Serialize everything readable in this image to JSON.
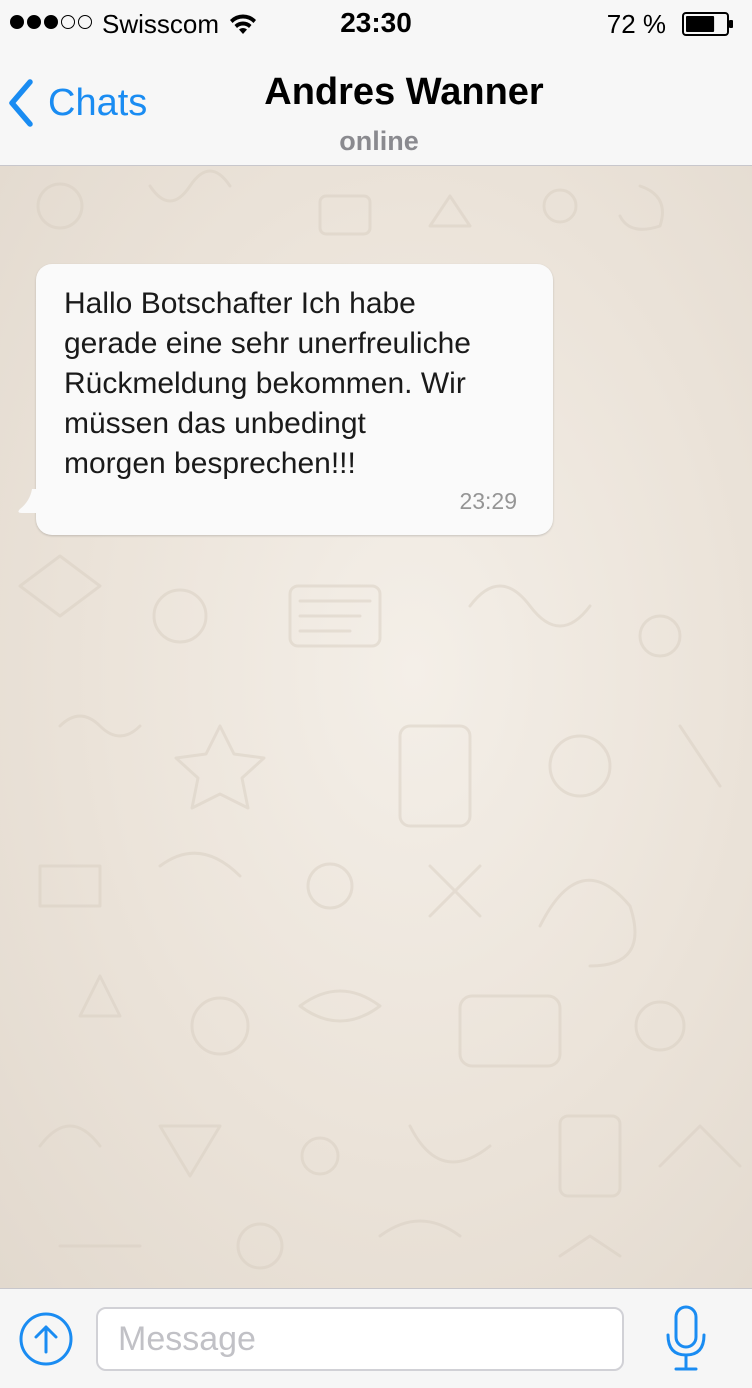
{
  "status_bar": {
    "carrier": "Swisscom",
    "signal_bars_filled": 3,
    "signal_bars_total": 5,
    "time": "23:30",
    "battery_text": "72 %",
    "battery_level": 0.72
  },
  "nav": {
    "back_label": "Chats",
    "contact_name": "Andres Wanner",
    "contact_status": "online"
  },
  "messages": [
    {
      "direction": "incoming",
      "text": "Hallo Botschafter Ich habe\ngerade eine sehr unerfreuliche\nRückmeldung bekommen. Wir\nmüssen das unbedingt\nmorgen besprechen!!!",
      "time": "23:29"
    }
  ],
  "input": {
    "placeholder": "Message",
    "value": ""
  },
  "icons": {
    "back": "chevron-left-icon",
    "attach": "arrow-up-circle-icon",
    "mic": "microphone-icon",
    "wifi": "wifi-icon",
    "battery": "battery-icon"
  },
  "colors": {
    "accent": "#1a8cf2",
    "bar_background": "#f7f7f7",
    "bubble_incoming": "#fafafa",
    "chat_background": "#ece5dd",
    "secondary_text": "#8a8a8f"
  }
}
